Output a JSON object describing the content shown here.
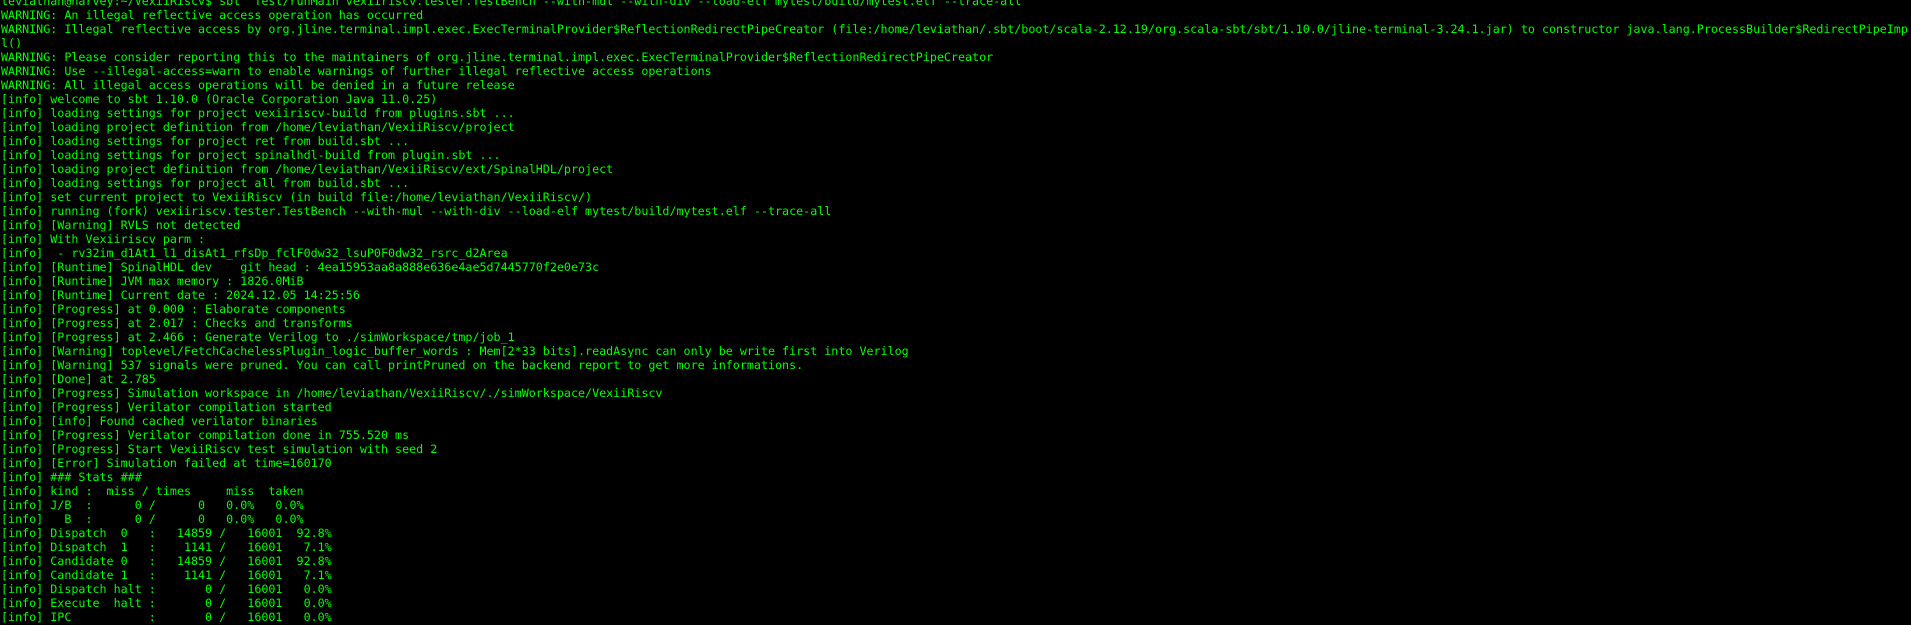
{
  "colors": {
    "background": "#000000",
    "foreground": "#00ff00"
  },
  "terminal": {
    "lines": [
      "leviathan@harvey:~/VexiiRiscv$ sbt \"Test/runMain vexiiriscv.tester.TestBench --with-mul --with-div --load-elf mytest/build/mytest.elf --trace-all\"",
      "WARNING: An illegal reflective access operation has occurred",
      "WARNING: Illegal reflective access by org.jline.terminal.impl.exec.ExecTerminalProvider$ReflectionRedirectPipeCreator (file:/home/leviathan/.sbt/boot/scala-2.12.19/org.scala-sbt/sbt/1.10.0/jline-terminal-3.24.1.jar) to constructor java.lang.ProcessBuilder$RedirectPipeImp",
      "l()",
      "WARNING: Please consider reporting this to the maintainers of org.jline.terminal.impl.exec.ExecTerminalProvider$ReflectionRedirectPipeCreator",
      "WARNING: Use --illegal-access=warn to enable warnings of further illegal reflective access operations",
      "WARNING: All illegal access operations will be denied in a future release",
      "[info] welcome to sbt 1.10.0 (Oracle Corporation Java 11.0.25)",
      "[info] loading settings for project vexiiriscv-build from plugins.sbt ...",
      "[info] loading project definition from /home/leviathan/VexiiRiscv/project",
      "[info] loading settings for project ret from build.sbt ...",
      "[info] loading settings for project spinalhdl-build from plugin.sbt ...",
      "[info] loading project definition from /home/leviathan/VexiiRiscv/ext/SpinalHDL/project",
      "[info] loading settings for project all from build.sbt ...",
      "[info] set current project to VexiiRiscv (in build file:/home/leviathan/VexiiRiscv/)",
      "[info] running (fork) vexiiriscv.tester.TestBench --with-mul --with-div --load-elf mytest/build/mytest.elf --trace-all",
      "[info] [Warning] RVLS not detected",
      "[info] With Vexiiriscv parm :",
      "[info]  - rv32im_d1At1_l1_disAt1_rfsDp_fclF0dw32_lsuP0F0dw32_rsrc_d2Area",
      "[info] [Runtime] SpinalHDL dev    git head : 4ea15953aa8a888e636e4ae5d7445770f2e0e73c",
      "[info] [Runtime] JVM max memory : 1826.0MiB",
      "[info] [Runtime] Current date : 2024.12.05 14:25:56",
      "[info] [Progress] at 0.000 : Elaborate components",
      "[info] [Progress] at 2.017 : Checks and transforms",
      "[info] [Progress] at 2.466 : Generate Verilog to ./simWorkspace/tmp/job_1",
      "[info] [Warning] toplevel/FetchCachelessPlugin_logic_buffer_words : Mem[2*33 bits].readAsync can only be write first into Verilog",
      "[info] [Warning] 537 signals were pruned. You can call printPruned on the backend report to get more informations.",
      "[info] [Done] at 2.785",
      "[info] [Progress] Simulation workspace in /home/leviathan/VexiiRiscv/./simWorkspace/VexiiRiscv",
      "[info] [Progress] Verilator compilation started",
      "[info] [info] Found cached verilator binaries",
      "[info] [Progress] Verilator compilation done in 755.520 ms",
      "[info] [Progress] Start VexiiRiscv test simulation with seed 2",
      "[info] [Error] Simulation failed at time=160170",
      "[info] ### Stats ###",
      "[info] kind :  miss / times     miss  taken",
      "[info] J/B  :      0 /      0   0.0%   0.0%",
      "[info]   B  :      0 /      0   0.0%   0.0%",
      "[info] Dispatch  0   :   14859 /   16001  92.8%",
      "[info] Dispatch  1   :    1141 /   16001   7.1%",
      "[info] Candidate 0   :   14859 /   16001  92.8%",
      "[info] Candidate 1   :    1141 /   16001   7.1%",
      "[info] Dispatch halt :       0 /   16001   0.0%",
      "[info] Execute  halt :       0 /   16001   0.0%",
      "[info] IPC           :       0 /   16001   0.0%"
    ]
  }
}
